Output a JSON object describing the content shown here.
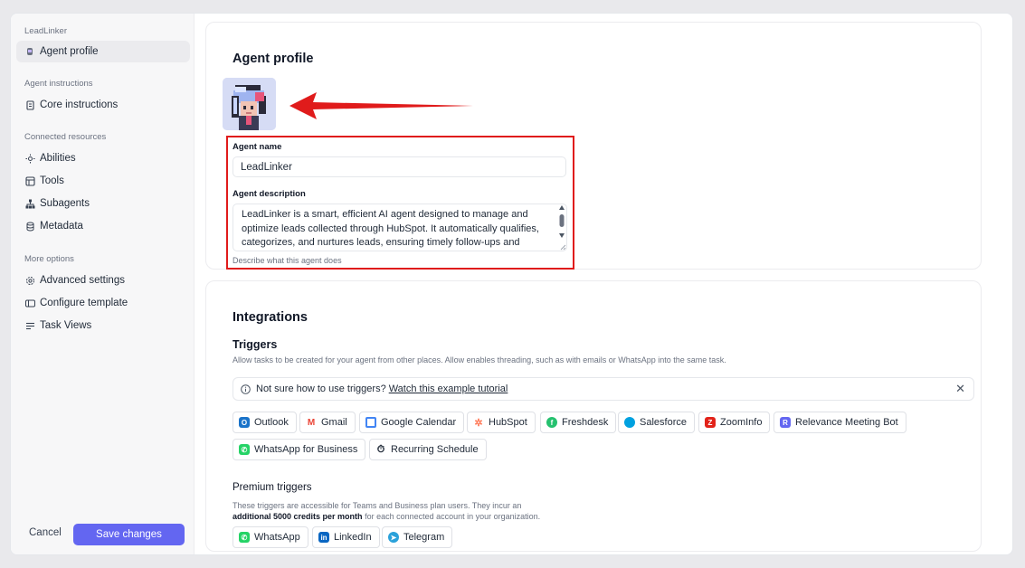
{
  "sidebar": {
    "app_name": "LeadLinker",
    "active_item": "Agent profile",
    "groups": {
      "agent_instructions": "Agent instructions",
      "connected_resources": "Connected resources",
      "more_options": "More options"
    },
    "items": {
      "core_instructions": "Core instructions",
      "abilities": "Abilities",
      "tools": "Tools",
      "subagents": "Subagents",
      "metadata": "Metadata",
      "advanced_settings": "Advanced settings",
      "configure_template": "Configure template",
      "task_views": "Task Views"
    },
    "cancel_label": "Cancel",
    "save_label": "Save changes"
  },
  "profile": {
    "title": "Agent profile",
    "name_label": "Agent name",
    "name_value": "LeadLinker",
    "description_label": "Agent description",
    "description_value": "LeadLinker is a smart, efficient AI agent designed to manage and optimize leads collected through HubSpot. It automatically qualifies, categorizes, and nurtures leads, ensuring timely follow-ups and personalized communication to drive higher engagement and conversion.",
    "description_help": "Describe what this agent does"
  },
  "integrations": {
    "title": "Integrations",
    "triggers_title": "Triggers",
    "triggers_desc": "Allow tasks to be created for your agent from other places. Allow enables threading, such as with emails or WhatsApp into the same task.",
    "tip_text": "Not sure how to use triggers?",
    "tip_link": "Watch this example tutorial",
    "triggers": [
      "Outlook",
      "Gmail",
      "Google Calendar",
      "HubSpot",
      "Freshdesk",
      "Salesforce",
      "ZoomInfo",
      "Relevance Meeting Bot",
      "WhatsApp for Business",
      "Recurring Schedule"
    ],
    "premium_title": "Premium triggers",
    "premium_desc_1": "These triggers are accessible for Teams and Business plan users. They incur an",
    "premium_desc_bold": "additional 5000 credits per month",
    "premium_desc_2": "for each connected account in your organization.",
    "premium_triggers": [
      "WhatsApp",
      "LinkedIn",
      "Telegram"
    ]
  },
  "colors": {
    "accent": "#6366f1",
    "annotation_red": "#e01b1b"
  }
}
